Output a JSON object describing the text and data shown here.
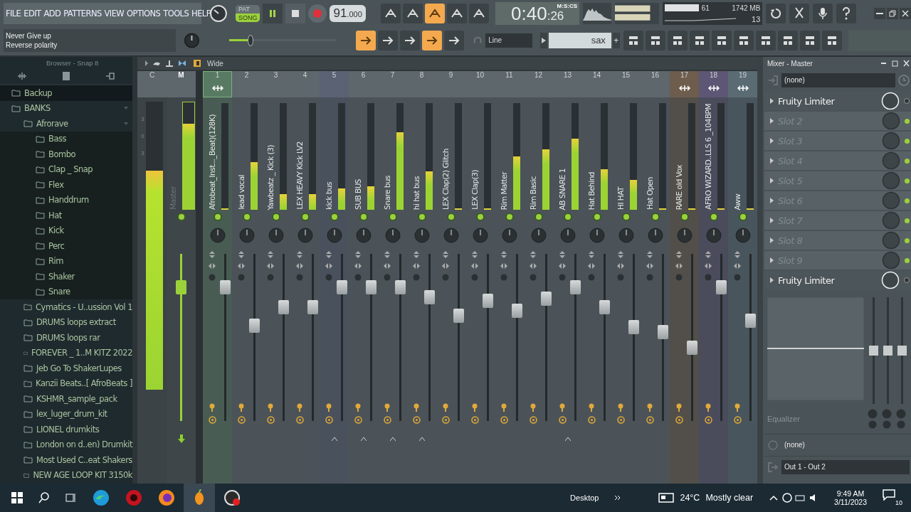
{
  "menu": [
    "FILE",
    "EDIT",
    "ADD",
    "PATTERNS",
    "VIEW",
    "OPTIONS",
    "TOOLS",
    "HELP"
  ],
  "transport": {
    "modes": [
      {
        "label": "PAT",
        "selected": false
      },
      {
        "label": "SONG",
        "selected": true
      }
    ],
    "tempo": "91",
    "tempo_fraction": ".000"
  },
  "toolbar_row1": [
    {
      "on": false
    },
    {
      "on": false
    },
    {
      "on": true
    },
    {
      "on": false
    },
    {
      "on": false
    }
  ],
  "time": {
    "value": "0:40",
    "centiseconds": ":26",
    "format": "M:S:CS"
  },
  "cpu": {
    "cpu": "61",
    "memory": "1742 MB",
    "polyphony": "13"
  },
  "hint": {
    "lines": [
      "Never Give up",
      "Reverse polarity"
    ]
  },
  "master_pitch": {
    "level": 0.23
  },
  "toolbar_row2": [
    {
      "on": true
    },
    {
      "on": false
    },
    {
      "on": false
    },
    {
      "on": true
    },
    {
      "on": false
    }
  ],
  "recording_source": "Line",
  "pattern": {
    "name": "sax",
    "add": "+"
  },
  "browser": {
    "title": "Browser - Snap 8",
    "tree": [
      {
        "label": "Backup",
        "selected": true
      },
      {
        "label": "BANKS",
        "selected": false,
        "expanded": true,
        "children": [
          {
            "label": "Afrorave",
            "selected": false,
            "expanded": true,
            "children": [
              {
                "label": "Bass",
                "selected": false
              },
              {
                "label": "Bombo",
                "selected": false
              },
              {
                "label": "Clap _ Snap",
                "selected": false
              },
              {
                "label": "Flex",
                "selected": false
              },
              {
                "label": "Handdrum",
                "selected": false
              },
              {
                "label": "Hat",
                "selected": false
              },
              {
                "label": "Kick",
                "selected": false
              },
              {
                "label": "Perc",
                "selected": false
              },
              {
                "label": "Rim",
                "selected": false
              },
              {
                "label": "Shaker",
                "selected": false
              },
              {
                "label": "Snare",
                "selected": false
              }
            ]
          },
          {
            "label": "Cymatics - U..ussion Vol 1",
            "selected": false
          },
          {
            "label": "DRUMS loops extract",
            "selected": false
          },
          {
            "label": "DRUMS loops rar",
            "selected": false
          },
          {
            "label": "FOREVER _ 1..M KITZ 2022",
            "selected": false
          },
          {
            "label": "Jeb Go To ShakerLupes",
            "selected": false
          },
          {
            "label": "Kanzii Beats..[ AfroBeats ]",
            "selected": false
          },
          {
            "label": "KSHMR_sample_pack",
            "selected": false
          },
          {
            "label": "lex_luger_drum_kit",
            "selected": false
          },
          {
            "label": "LIONEL drumkits",
            "selected": false
          },
          {
            "label": "London on d..en) Drumkit",
            "selected": false
          },
          {
            "label": "Most Used C..eat Shakers",
            "selected": false
          },
          {
            "label": "NEW AGE LOOP KIT 3150k",
            "selected": false
          }
        ]
      }
    ]
  },
  "mixer": {
    "mode": "Wide",
    "current": {
      "number": "C",
      "scale": [
        "3",
        "0",
        "3"
      ],
      "meter": {
        "level": 0.76
      }
    },
    "master": {
      "number": "M",
      "name": "Master",
      "selected": true,
      "meter": {
        "level": 0.8
      },
      "fader": {
        "level": 0.8
      }
    },
    "channels": [
      {
        "number": "1",
        "name": "Afrobeat_Inst..._Beat)(128K)",
        "selected": true,
        "color": "#587a63",
        "send": true,
        "arrow": false,
        "meter": {
          "level": 0
        },
        "fader": {
          "level": 0.8
        }
      },
      {
        "number": "2",
        "name": "lead vocal",
        "selected": false,
        "color": "#5e676c",
        "send": false,
        "arrow": false,
        "meter": {
          "level": 0.45
        },
        "fader": {
          "level": 0.57
        }
      },
      {
        "number": "3",
        "name": "Yawbeatz _ Kick (3)",
        "selected": false,
        "color": "#5e676c",
        "send": false,
        "arrow": false,
        "meter": {
          "level": 0.15
        },
        "fader": {
          "level": 0.68
        }
      },
      {
        "number": "4",
        "name": "LEX HEAVY Kick LV2",
        "selected": false,
        "color": "#5e676c",
        "send": false,
        "arrow": false,
        "meter": {
          "level": 0.15
        },
        "fader": {
          "level": 0.68
        }
      },
      {
        "number": "5",
        "name": "kick bus",
        "selected": false,
        "color": "#5a6274",
        "send": false,
        "arrow": true,
        "meter": {
          "level": 0.2
        },
        "fader": {
          "level": 0.8
        }
      },
      {
        "number": "6",
        "name": "SUB BUS",
        "selected": false,
        "color": "#5e676c",
        "send": false,
        "arrow": true,
        "meter": {
          "level": 0.22
        },
        "fader": {
          "level": 0.8
        }
      },
      {
        "number": "7",
        "name": "Snare bus",
        "selected": false,
        "color": "#5e676c",
        "send": false,
        "arrow": true,
        "meter": {
          "level": 0.73
        },
        "fader": {
          "level": 0.8
        }
      },
      {
        "number": "8",
        "name": "hi hat bus",
        "selected": false,
        "color": "#5e676c",
        "send": false,
        "arrow": true,
        "meter": {
          "level": 0.36
        },
        "fader": {
          "level": 0.74
        }
      },
      {
        "number": "9",
        "name": "LEX Clap(2) Glitch",
        "selected": false,
        "color": "#5e676c",
        "send": false,
        "arrow": false,
        "meter": {
          "level": 0
        },
        "fader": {
          "level": 0.63
        }
      },
      {
        "number": "10",
        "name": "LEX Clap(3)",
        "selected": false,
        "color": "#5e676c",
        "send": false,
        "arrow": false,
        "meter": {
          "level": 0
        },
        "fader": {
          "level": 0.72
        }
      },
      {
        "number": "11",
        "name": "Rim Matter",
        "selected": false,
        "color": "#5e676c",
        "send": false,
        "arrow": false,
        "meter": {
          "level": 0.5
        },
        "fader": {
          "level": 0.66
        }
      },
      {
        "number": "12",
        "name": "Rim Basic",
        "selected": false,
        "color": "#5e676c",
        "send": false,
        "arrow": false,
        "meter": {
          "level": 0.57
        },
        "fader": {
          "level": 0.73
        }
      },
      {
        "number": "13",
        "name": "AB SNARE 1",
        "selected": false,
        "color": "#5e676c",
        "send": false,
        "arrow": true,
        "meter": {
          "level": 0.67
        },
        "fader": {
          "level": 0.8
        }
      },
      {
        "number": "14",
        "name": "Hat Behind",
        "selected": false,
        "color": "#5e676c",
        "send": false,
        "arrow": false,
        "meter": {
          "level": 0.38
        },
        "fader": {
          "level": 0.68
        }
      },
      {
        "number": "15",
        "name": "HI HAT",
        "selected": false,
        "color": "#5e676c",
        "send": false,
        "arrow": false,
        "meter": {
          "level": 0.28
        },
        "fader": {
          "level": 0.56
        }
      },
      {
        "number": "16",
        "name": "Hat Open",
        "selected": false,
        "color": "#5e676c",
        "send": false,
        "arrow": false,
        "meter": {
          "level": 0
        },
        "fader": {
          "level": 0.53
        }
      },
      {
        "number": "17",
        "name": "RARE old Vox",
        "selected": false,
        "color": "#6e5d4d",
        "send": true,
        "arrow": false,
        "meter": {
          "level": 0
        },
        "fader": {
          "level": 0.44
        }
      },
      {
        "number": "18",
        "name": "AFRO WIZARD..LLS 6 _104BPM",
        "selected": false,
        "color": "#5d5675",
        "send": true,
        "arrow": false,
        "meter": {
          "level": 0
        },
        "fader": {
          "level": 0.8
        }
      },
      {
        "number": "19",
        "name": "Aww",
        "selected": false,
        "color": "#5b6b74",
        "send": true,
        "arrow": false,
        "meter": {
          "level": 0
        },
        "fader": {
          "level": 0.6
        }
      }
    ]
  },
  "panel": {
    "title": "Mixer - Master",
    "input": "(none)",
    "slots": [
      {
        "name": "Fruity Limiter",
        "filled": true
      },
      {
        "name": "Slot 2",
        "filled": false
      },
      {
        "name": "Slot 3",
        "filled": false
      },
      {
        "name": "Slot 4",
        "filled": false
      },
      {
        "name": "Slot 5",
        "filled": false
      },
      {
        "name": "Slot 6",
        "filled": false
      },
      {
        "name": "Slot 7",
        "filled": false
      },
      {
        "name": "Slot 8",
        "filled": false
      },
      {
        "name": "Slot 9",
        "filled": false
      },
      {
        "name": "Fruity Limiter",
        "filled": true
      }
    ],
    "eq_label": "Equalizer",
    "output_effect": "(none)",
    "output": "Out 1 - Out 2"
  },
  "taskbar": {
    "desktop": "Desktop",
    "temperature": "24°C",
    "weather": "Mostly clear",
    "time": "9:49 AM",
    "date": "3/11/2023",
    "notifications": "10"
  }
}
